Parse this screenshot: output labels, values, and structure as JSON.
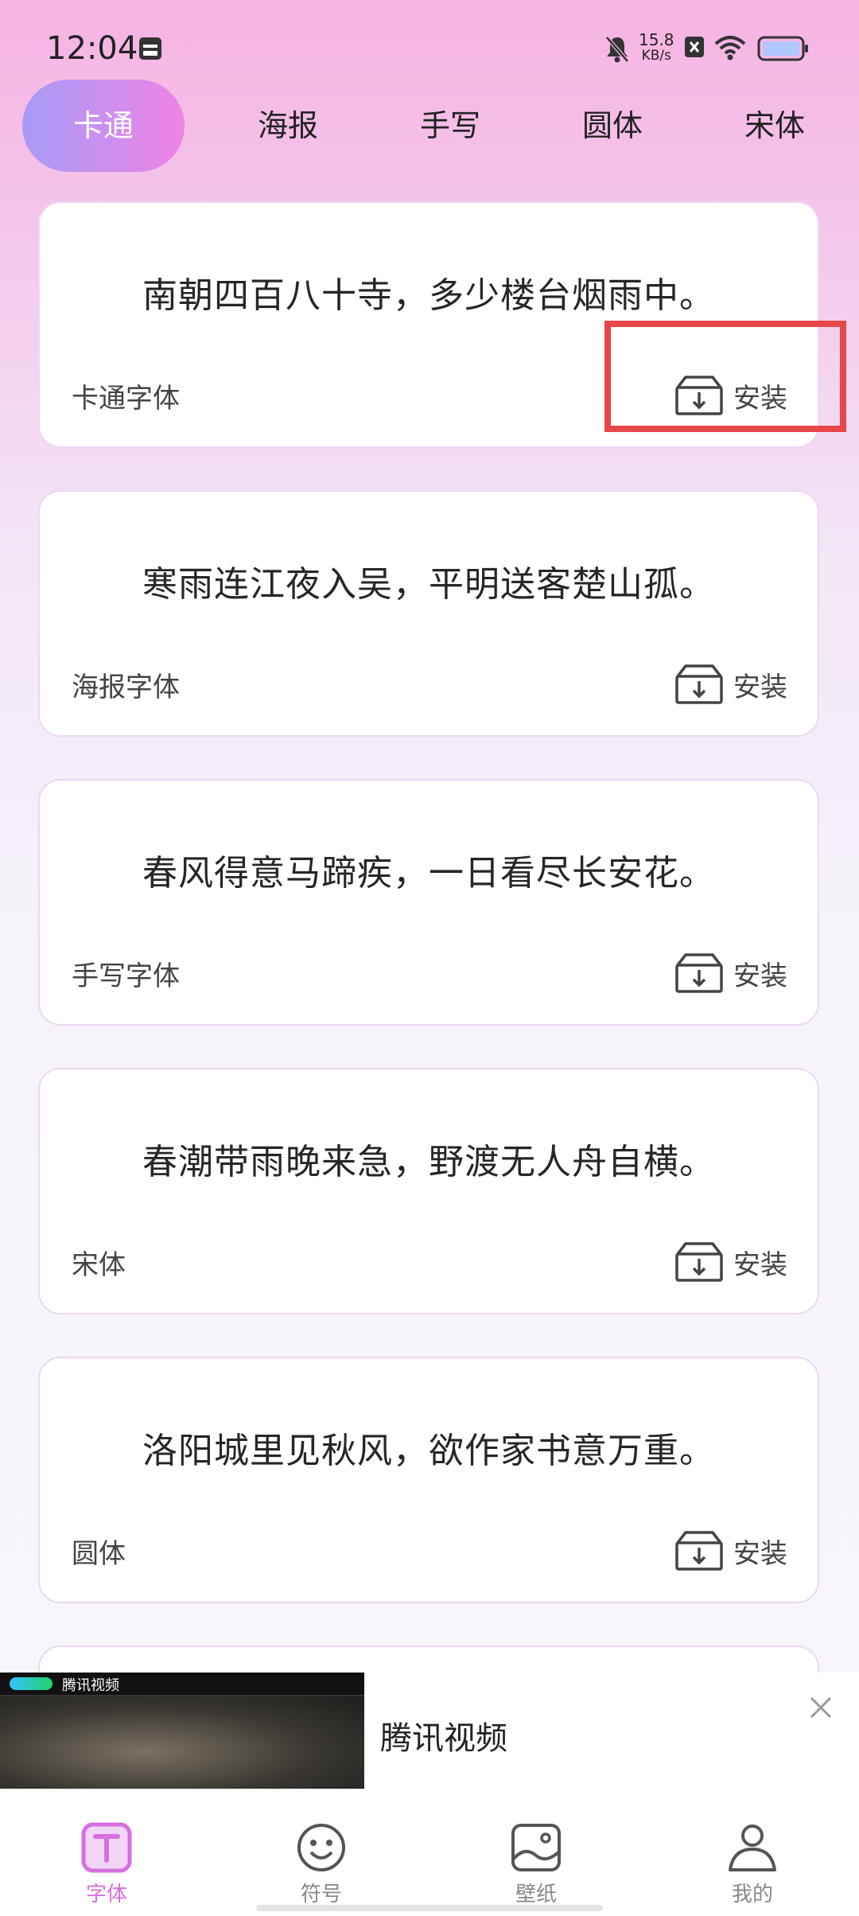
{
  "status_bar": {
    "time": "12:04",
    "net_speed": "15.8",
    "net_unit": "KB/s",
    "icons": [
      "calendar-icon",
      "mute-bell-icon",
      "close-box-icon",
      "wifi-icon",
      "battery-icon"
    ]
  },
  "tabs": [
    {
      "label": "卡通",
      "active": true
    },
    {
      "label": "海报",
      "active": false
    },
    {
      "label": "手写",
      "active": false
    },
    {
      "label": "圆体",
      "active": false
    },
    {
      "label": "宋体",
      "active": false
    }
  ],
  "cards": [
    {
      "poem": "南朝四百八十寺，多少楼台烟雨中。",
      "font_type": "卡通字体",
      "install_label": "安装"
    },
    {
      "poem": "寒雨连江夜入吴，平明送客楚山孤。",
      "font_type": "海报字体",
      "install_label": "安装"
    },
    {
      "poem": "春风得意马蹄疾，一日看尽长安花。",
      "font_type": "手写字体",
      "install_label": "安装"
    },
    {
      "poem": "春潮带雨晚来急，野渡无人舟自横。",
      "font_type": "宋体",
      "install_label": "安装"
    },
    {
      "poem": "洛阳城里见秋风，欲作家书意万重。",
      "font_type": "圆体",
      "install_label": "安装"
    }
  ],
  "ad": {
    "thumb_logo_text": "腾讯视频",
    "title": "腾讯视频"
  },
  "bottom_nav": [
    {
      "label": "字体",
      "icon": "font-t-icon",
      "active": true
    },
    {
      "label": "符号",
      "icon": "smiley-icon",
      "active": false
    },
    {
      "label": "壁纸",
      "icon": "image-icon",
      "active": false
    },
    {
      "label": "我的",
      "icon": "person-icon",
      "active": false
    }
  ],
  "colors": {
    "accent": "#D86FE0",
    "tab_gradient_start": "#A79BF7",
    "tab_gradient_end": "#F083E5",
    "highlight": "#E8474A"
  }
}
